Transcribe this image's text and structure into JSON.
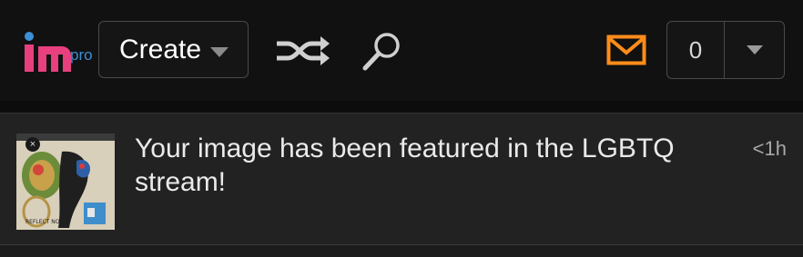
{
  "header": {
    "logo_text": "im",
    "logo_badge": "pro",
    "create_label": "Create",
    "notification_count": "0",
    "icons": {
      "shuffle": "shuffle-icon",
      "search": "search-icon",
      "mail": "mail-icon"
    },
    "colors": {
      "mail": "#ff8c1a",
      "logo_m": "#e03f8c",
      "logo_badge": "#3d8fd6"
    }
  },
  "notification": {
    "message": "Your image has been featured in the LGBTQ stream!",
    "time": "<1h",
    "thumbnail_text": "REFLECT NO U"
  }
}
